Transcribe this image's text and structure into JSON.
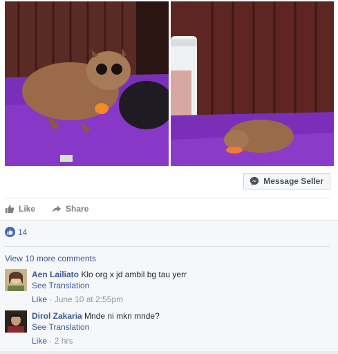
{
  "post": {
    "photos": [
      {
        "icon": "loris-photo-left"
      },
      {
        "icon": "loris-photo-right"
      }
    ],
    "message_seller": {
      "label": "Message Seller",
      "icon": "messenger-icon"
    }
  },
  "actions": {
    "like": {
      "label": "Like",
      "icon": "thumbs-up-icon"
    },
    "share": {
      "label": "Share",
      "icon": "share-arrow-icon"
    }
  },
  "reactions": {
    "count": "14",
    "icon": "like-reaction-icon",
    "color": "#4267b2"
  },
  "comments": {
    "view_more": "View 10 more comments",
    "items": [
      {
        "author": "Aen Lailiato",
        "text": "Klo org x jd ambil bg tau yerr",
        "translation": "See Translation",
        "like": "Like",
        "time": "June 10 at 2:55pm"
      },
      {
        "author": "Dirol Zakaria",
        "text": "Mnde ni mkn mnde?",
        "translation": "See Translation",
        "like": "Like",
        "time": "2 hrs"
      }
    ]
  },
  "colors": {
    "link": "#365899",
    "muted": "#90949c",
    "accent": "#4267b2"
  }
}
